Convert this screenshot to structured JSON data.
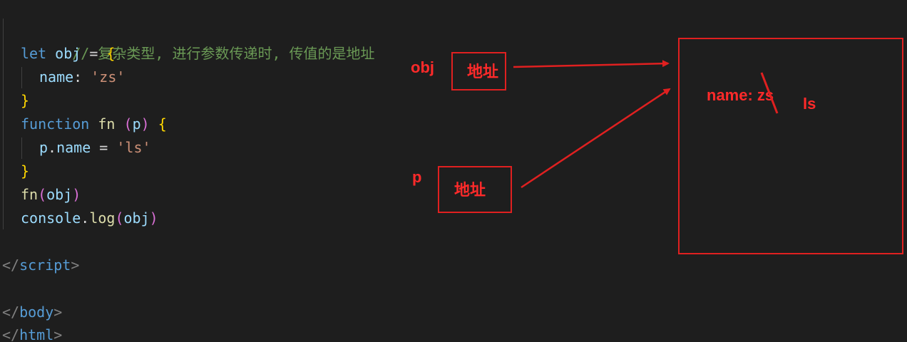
{
  "code": {
    "comment": "// 复杂类型, 进行参数传递时, 传值的是地址",
    "let_kw": "let",
    "obj_name": "obj",
    "assign_op": " = ",
    "open_brace": "{",
    "prop_name": "name",
    "colon": ": ",
    "zs_string": "'zs'",
    "close_brace": "}",
    "function_kw": "function",
    "fn_name": "fn",
    "space": " ",
    "open_paren": "(",
    "param_p": "p",
    "close_paren": ")",
    "p_ref": "p",
    "dot": ".",
    "ls_string": "'ls'",
    "call_fn": "fn",
    "call_arg": "obj",
    "console": "console",
    "log": "log",
    "log_arg": "obj",
    "script_close": "script",
    "body_close": "body",
    "html_close": "html",
    "lt_slash": "</",
    "gt": ">"
  },
  "annotations": {
    "obj_label": "obj",
    "obj_box_text": "地址",
    "p_label": "p",
    "p_box_text": "地址",
    "heap_prop": "name: zs",
    "heap_new_value": "ls"
  },
  "colors": {
    "annotation_red": "#ff2a2a",
    "editor_bg": "#1e1e1e",
    "comment_green": "#6a9955",
    "keyword_blue": "#569cd6",
    "variable_lightblue": "#9cdcfe",
    "function_yellow": "#dcdcaa",
    "string_orange": "#ce9178",
    "brace_gold": "#ffd700",
    "paren_pink": "#da70d6"
  }
}
